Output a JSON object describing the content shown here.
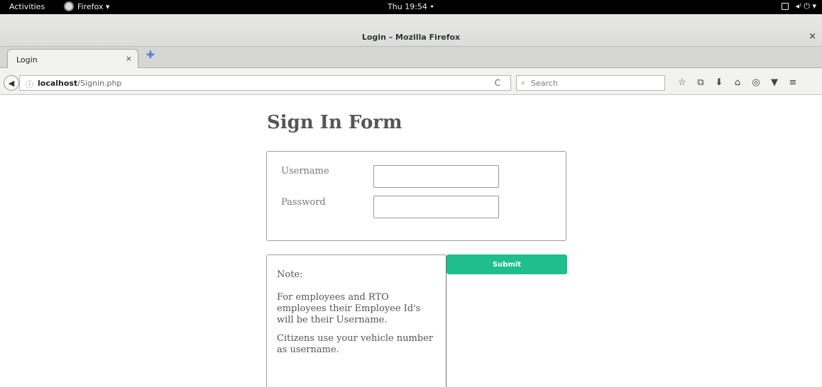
{
  "topbar": {
    "activities": "Activities",
    "app_menu": "Firefox ▾",
    "clock": "Thu 19:54 •",
    "status_glyphs": "◂⁾  ⏻ ▾"
  },
  "window": {
    "title": "Login – Mozilla Firefox",
    "close": "×"
  },
  "tabs": [
    {
      "label": "Login",
      "close": "×"
    }
  ],
  "new_tab": "✚",
  "navbar": {
    "back": "◀",
    "info": "ⓘ",
    "url_host": "localhost",
    "url_path": "/Signin.php",
    "reload": "C",
    "search_placeholder": "Search",
    "icons": [
      "star-icon",
      "library-icon",
      "download-icon",
      "home-icon",
      "chat-icon",
      "pocket-icon",
      "menu-icon"
    ]
  },
  "page": {
    "title": "Sign In Form",
    "username_label": "Username",
    "password_label": "Password",
    "submit_label": "Submit",
    "note_title": "Note:",
    "note_line1": "For employees and RTO employees their Employee Id's will be their Username.",
    "note_line2": "Citizens use your vehicle number as username."
  },
  "colors": {
    "submit": "#1fbe8d",
    "topbar": "#000000"
  }
}
